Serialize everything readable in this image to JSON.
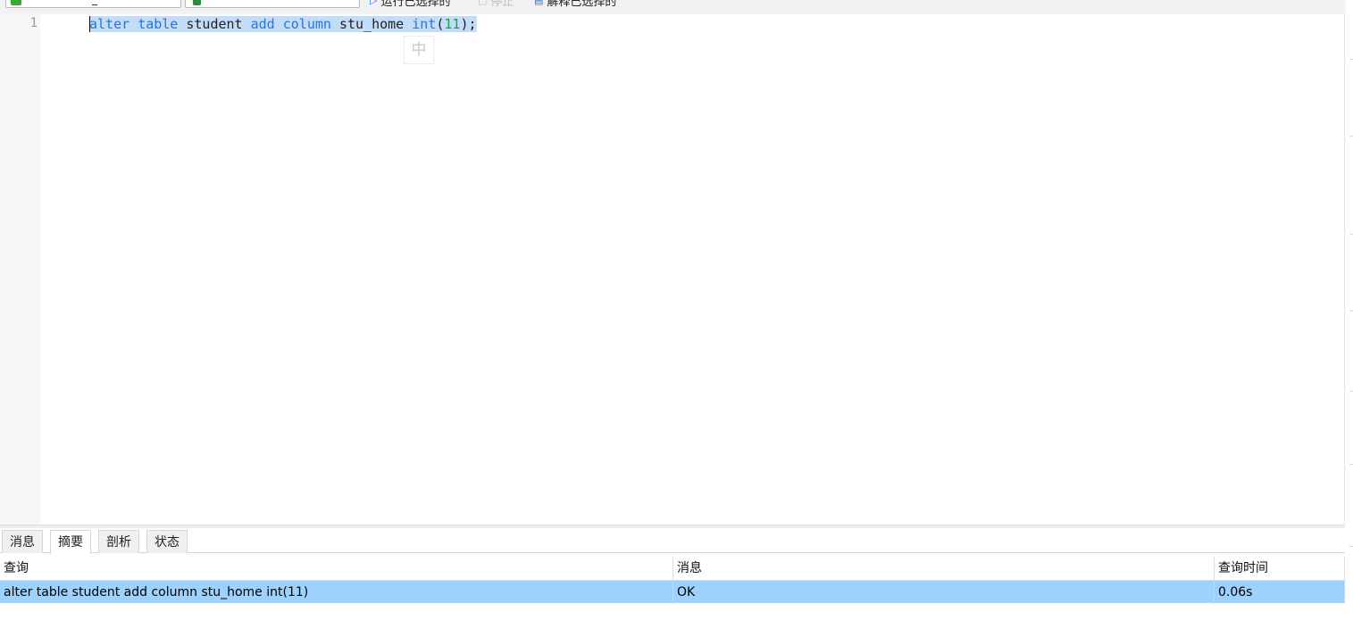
{
  "toolbar": {
    "connection_select": {
      "icon": "connection-icon",
      "icon_color": "#3aaa35"
    },
    "database_select": {
      "icon": "database-icon",
      "icon_color": "#2e8b3e"
    },
    "run_selected_label": "运行已选择的",
    "stop_label": "停止",
    "explain_selected_label": "解释已选择的"
  },
  "editor": {
    "line_number": "1",
    "code": {
      "kw1": "alter",
      "kw2": "table",
      "id1": "student",
      "kw3": "add",
      "kw4": "column",
      "id2": "stu_home",
      "kw5": "int",
      "paren_open": "(",
      "num": "11",
      "paren_close": ");"
    },
    "ime_indicator": "中"
  },
  "results": {
    "tabs": [
      {
        "label": "消息",
        "active": false
      },
      {
        "label": "摘要",
        "active": true
      },
      {
        "label": "剖析",
        "active": false
      },
      {
        "label": "状态",
        "active": false
      }
    ],
    "columns": [
      "查询",
      "消息",
      "查询时间"
    ],
    "rows": [
      {
        "query": "alter table student add column stu_home int(11)",
        "message": "OK",
        "time": "0.06s"
      }
    ]
  },
  "colors": {
    "keyword": "#2f72d8",
    "number": "#18a34a",
    "selection": "#c3dcf7",
    "row_highlight": "#9ed1fb"
  }
}
